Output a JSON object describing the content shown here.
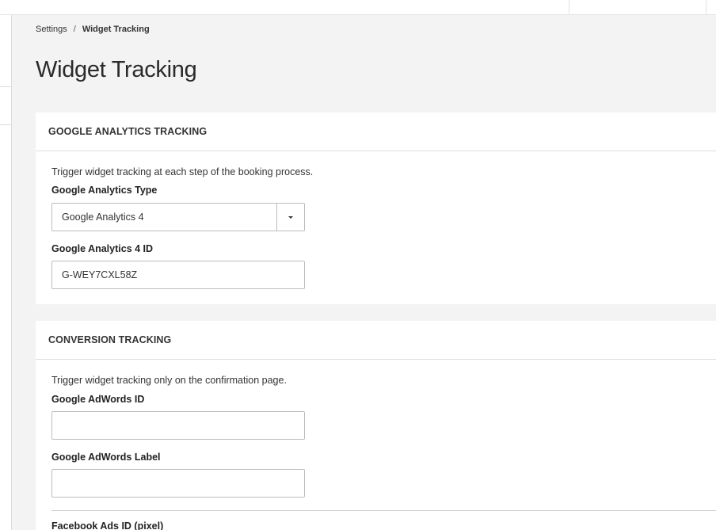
{
  "breadcrumb": {
    "parent": "Settings",
    "separator": "/",
    "current": "Widget Tracking"
  },
  "page": {
    "title": "Widget Tracking"
  },
  "google_analytics": {
    "header": "GOOGLE ANALYTICS TRACKING",
    "description": "Trigger widget tracking at each step of the booking process.",
    "type_label": "Google Analytics Type",
    "type_value": "Google Analytics 4",
    "id_label": "Google Analytics 4 ID",
    "id_value": "G-WEY7CXL58Z"
  },
  "conversion": {
    "header": "CONVERSION TRACKING",
    "description": "Trigger widget tracking only on the confirmation page.",
    "adwords_id_label": "Google AdWords ID",
    "adwords_id_value": "",
    "adwords_label_label": "Google AdWords Label",
    "adwords_label_value": "",
    "facebook_label": "Facebook Ads ID (pixel)"
  }
}
